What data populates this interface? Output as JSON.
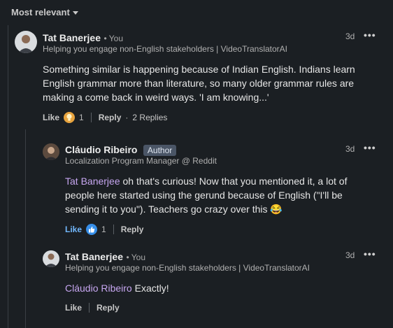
{
  "sort": {
    "label": "Most relevant"
  },
  "comments": [
    {
      "name": "Tat Banerjee",
      "you": "• You",
      "headline": "Helping you engage non-English stakeholders | VideoTranslatorAI",
      "time": "3d",
      "text": "Something similar is happening because of Indian English. Indians learn English grammar more than literature, so many older grammar rules are making a come back in weird ways. 'I am knowing...'",
      "like_label": "Like",
      "reaction_count": "1",
      "reply_label": "Reply",
      "replies_label": "2 Replies"
    },
    {
      "name": "Cláudio Ribeiro",
      "badge": "Author",
      "headline": "Localization Program Manager @ Reddit",
      "time": "3d",
      "mention": "Tat Banerjee",
      "text": " oh that's curious! Now that you mentioned it, a lot of people here started using the gerund because of English (\"I'll be sending it to you\"). Teachers go crazy over this 😂",
      "like_label": "Like",
      "reaction_count": "1",
      "reply_label": "Reply"
    },
    {
      "name": "Tat Banerjee",
      "you": "• You",
      "headline": "Helping you engage non-English stakeholders | VideoTranslatorAI",
      "time": "3d",
      "mention": "Cláudio Ribeiro",
      "text": " Exactly!",
      "like_label": "Like",
      "reply_label": "Reply"
    }
  ],
  "colors": {
    "background": "#1b1f23",
    "mention": "#c6a6f0",
    "liked": "#71b7fb",
    "badge": "#4a5566"
  }
}
